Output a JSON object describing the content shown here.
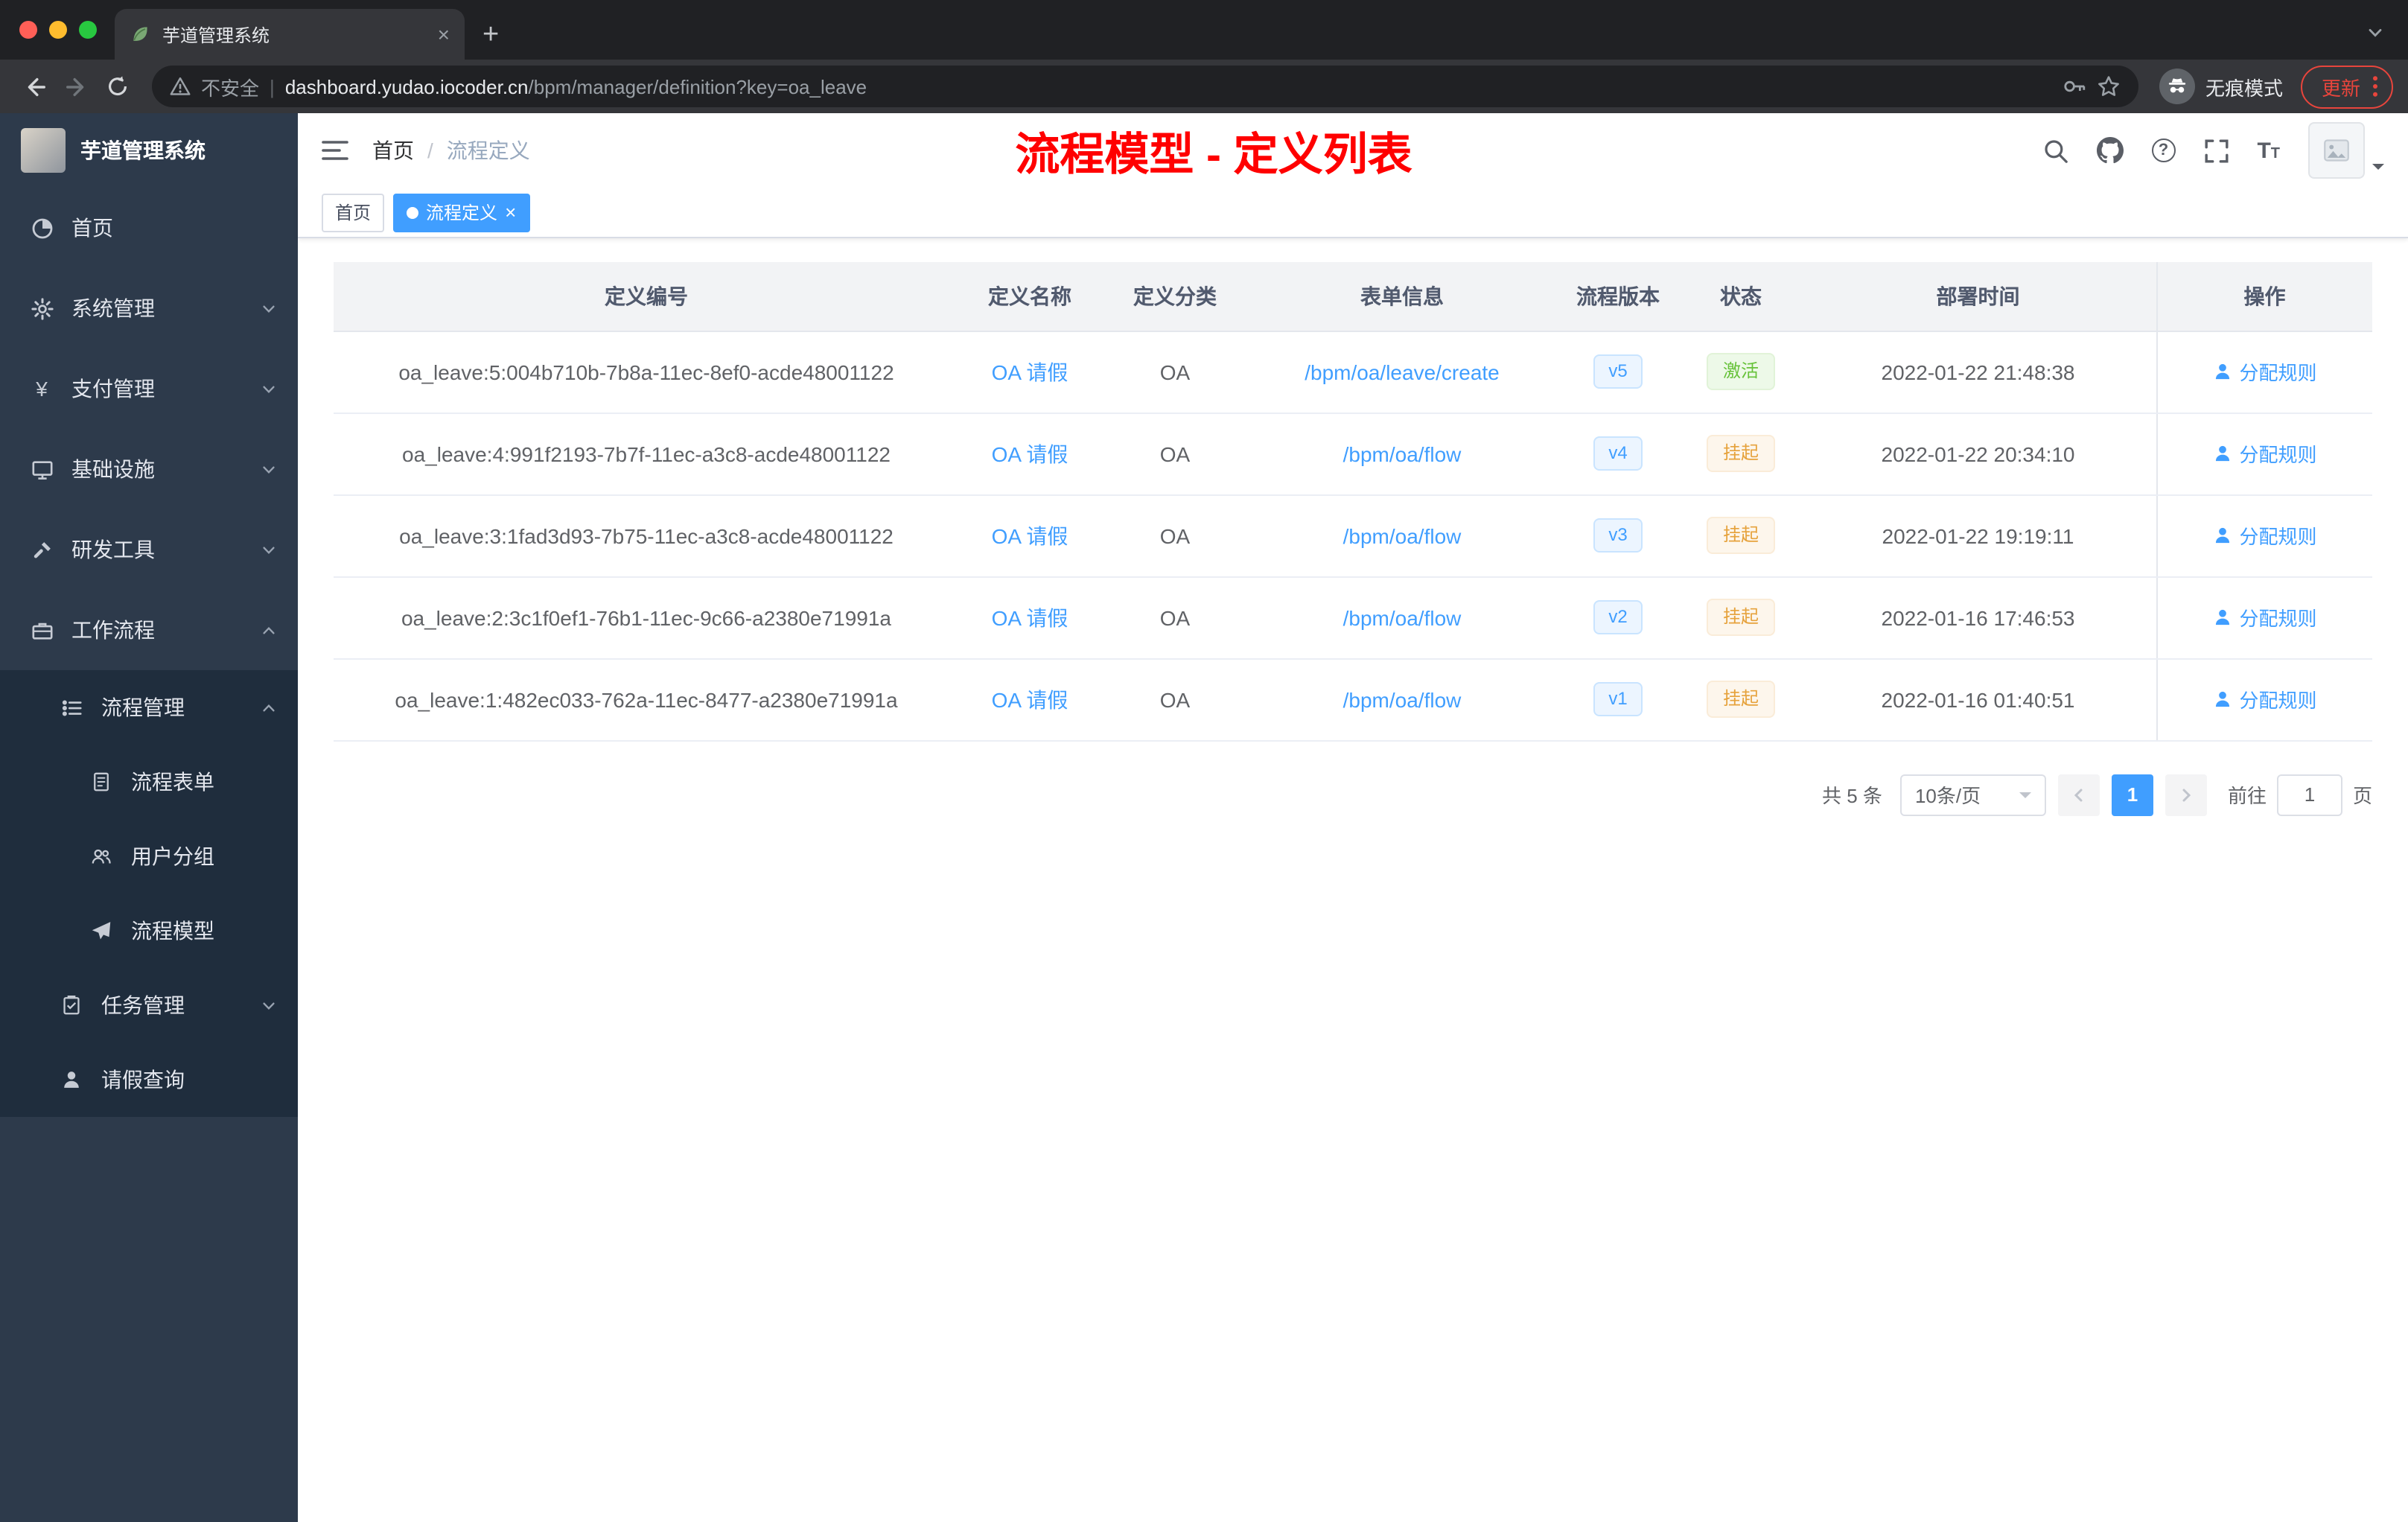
{
  "chrome": {
    "tab": {
      "title": "芋道管理系统"
    },
    "nav": {
      "security_label": "不安全",
      "url_host": "dashboard.yudao.iocoder.cn",
      "url_path": "/bpm/manager/definition?key=oa_leave",
      "incognito_label": "无痕模式",
      "update_label": "更新"
    }
  },
  "sidebar": {
    "logo_title": "芋道管理系统",
    "items": [
      {
        "label": "首页",
        "icon": "dashboard-icon"
      },
      {
        "label": "系统管理",
        "icon": "gear-icon"
      },
      {
        "label": "支付管理",
        "icon": "yen-icon"
      },
      {
        "label": "基础设施",
        "icon": "monitor-icon"
      },
      {
        "label": "研发工具",
        "icon": "tools-icon"
      },
      {
        "label": "工作流程",
        "icon": "workflow-icon"
      }
    ],
    "submenu": {
      "group_label": "流程管理",
      "group_icon": "process-list-icon",
      "children": [
        {
          "label": "流程表单",
          "icon": "form-icon"
        },
        {
          "label": "用户分组",
          "icon": "user-group-icon"
        },
        {
          "label": "流程模型",
          "icon": "paper-plane-icon"
        }
      ],
      "siblings": [
        {
          "label": "任务管理",
          "icon": "task-icon"
        },
        {
          "label": "请假查询",
          "icon": "person-icon"
        }
      ]
    }
  },
  "header": {
    "breadcrumb_home": "首页",
    "breadcrumb_sep": "/",
    "breadcrumb_current": "流程定义",
    "annotation": "流程模型 - 定义列表",
    "annotation_color": "#ff0000"
  },
  "tags": {
    "home": "首页",
    "active": "流程定义"
  },
  "table": {
    "columns": {
      "id": "定义编号",
      "name": "定义名称",
      "category": "定义分类",
      "form": "表单信息",
      "version": "流程版本",
      "status": "状态",
      "time": "部署时间",
      "action": "操作"
    },
    "rows": [
      {
        "id": "oa_leave:5:004b710b-7b8a-11ec-8ef0-acde48001122",
        "name": "OA 请假",
        "category": "OA",
        "form": "/bpm/oa/leave/create",
        "version": "v5",
        "status": "激活",
        "status_type": "success",
        "time": "2022-01-22 21:48:38",
        "action": "分配规则"
      },
      {
        "id": "oa_leave:4:991f2193-7b7f-11ec-a3c8-acde48001122",
        "name": "OA 请假",
        "category": "OA",
        "form": "/bpm/oa/flow",
        "version": "v4",
        "status": "挂起",
        "status_type": "warning",
        "time": "2022-01-22 20:34:10",
        "action": "分配规则"
      },
      {
        "id": "oa_leave:3:1fad3d93-7b75-11ec-a3c8-acde48001122",
        "name": "OA 请假",
        "category": "OA",
        "form": "/bpm/oa/flow",
        "version": "v3",
        "status": "挂起",
        "status_type": "warning",
        "time": "2022-01-22 19:19:11",
        "action": "分配规则"
      },
      {
        "id": "oa_leave:2:3c1f0ef1-76b1-11ec-9c66-a2380e71991a",
        "name": "OA 请假",
        "category": "OA",
        "form": "/bpm/oa/flow",
        "version": "v2",
        "status": "挂起",
        "status_type": "warning",
        "time": "2022-01-16 17:46:53",
        "action": "分配规则"
      },
      {
        "id": "oa_leave:1:482ec033-762a-11ec-8477-a2380e71991a",
        "name": "OA 请假",
        "category": "OA",
        "form": "/bpm/oa/flow",
        "version": "v1",
        "status": "挂起",
        "status_type": "warning",
        "time": "2022-01-16 01:40:51",
        "action": "分配规则"
      }
    ]
  },
  "pagination": {
    "total": "共 5 条",
    "page_size": "10条/页",
    "page": "1",
    "jump_prefix": "前往",
    "jump_value": "1",
    "jump_suffix": "页"
  },
  "colors": {
    "accent": "#409eff",
    "status_active": "#67c23a",
    "status_suspended": "#e6a23c",
    "annotation_red": "#ff0000",
    "sidebar_bg": "#2d3a4b",
    "submenu_bg": "#1f2d3d"
  },
  "icon_glyphs": {
    "close": "×",
    "plus": "+",
    "yen": "¥",
    "help": "?",
    "font_size_big": "T",
    "font_size_small": "T"
  }
}
